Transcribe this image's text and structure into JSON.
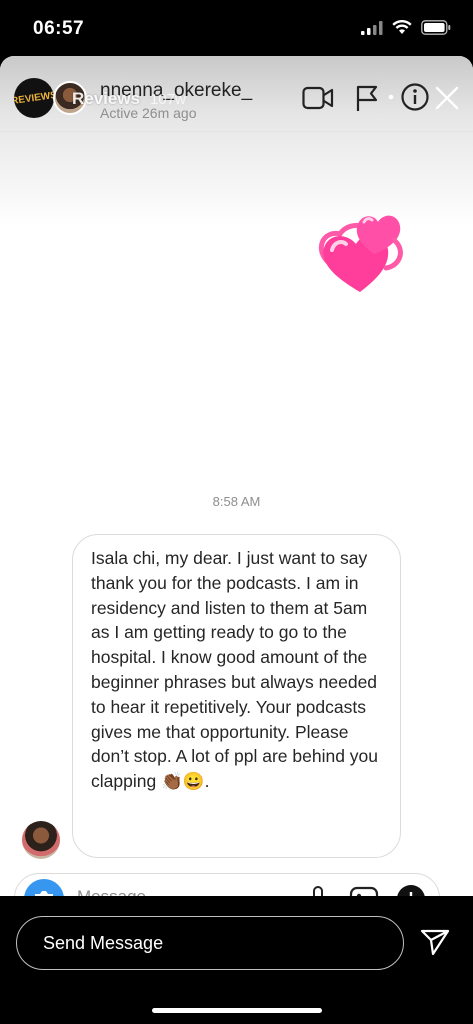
{
  "status_bar": {
    "time": "06:57"
  },
  "story": {
    "title": "Reviews",
    "age": "107w",
    "progress": 1.0,
    "reply_placeholder": "Send Message"
  },
  "thread": {
    "username": "nnenna_okereke_",
    "status": "Active 26m ago",
    "timestamp": "8:58 AM",
    "message": "Isala chi, my dear. I just want to say thank you for the podcasts. I am in residency and listen to them at 5am as I am getting ready to go to the hospital. I know good amount of the beginner phrases but always needed to hear it repetitively. Your podcasts gives me that opportunity. Please don’t stop. A lot of ppl are behind you clapping 👏🏾😀.",
    "composer_placeholder": "Message..."
  },
  "icons": [
    "video-call-icon",
    "flag-icon",
    "info-icon",
    "close-icon",
    "two-hearts-icon",
    "camera-icon",
    "mic-icon",
    "image-icon",
    "plus-icon",
    "send-icon"
  ],
  "colors": {
    "accent": "#3797f0",
    "heart": "#ff3d9a"
  }
}
